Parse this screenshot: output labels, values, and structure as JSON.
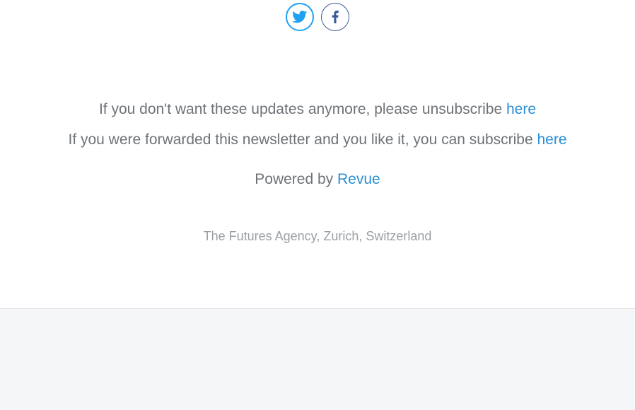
{
  "social": {
    "twitter_icon": "twitter-icon",
    "facebook_icon": "facebook-icon",
    "twitter_color": "#1da1f2",
    "facebook_color": "#3b5998"
  },
  "footer": {
    "unsubscribe_text": "If you don't want these updates anymore, please unsubscribe ",
    "unsubscribe_link": "here",
    "subscribe_text": "If you were forwarded this newsletter and you like it, you can subscribe ",
    "subscribe_link": "here",
    "powered_text": "Powered by ",
    "powered_link": "Revue",
    "address": "The Futures Agency, Zurich, Switzerland"
  },
  "colors": {
    "link": "#2a8fd6",
    "text": "#6e7378",
    "muted": "#9a9fa4",
    "bottom_background": "#f5f6f8"
  }
}
